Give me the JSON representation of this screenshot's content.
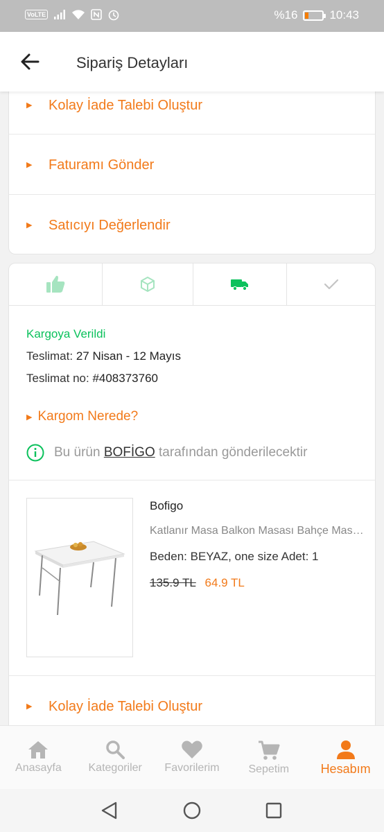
{
  "status_bar": {
    "network": "VoLTE",
    "battery_text": "%16",
    "battery_level": 0.16,
    "time": "10:43"
  },
  "header": {
    "title": "Sipariş Detayları",
    "back_icon": "arrow-left-icon"
  },
  "top_actions": [
    {
      "label": "Kolay İade Talebi Oluştur"
    },
    {
      "label": "Faturamı Gönder"
    },
    {
      "label": "Satıcıyı Değerlendir"
    }
  ],
  "tracking_steps": [
    {
      "icon": "thumbs-up-icon",
      "state": "done"
    },
    {
      "icon": "box-icon",
      "state": "done"
    },
    {
      "icon": "truck-icon",
      "state": "active"
    },
    {
      "icon": "check-icon",
      "state": "pending"
    }
  ],
  "shipment": {
    "status": "Kargoya Verildi",
    "delivery_label": "Teslimat:",
    "delivery_value": "27 Nisan - 12 Mayıs",
    "tracking_label": "Teslimat no:",
    "tracking_value": "#408373760",
    "where_link": "Kargom Nerede?",
    "info_prefix": "Bu ürün",
    "seller": "BOFİGO",
    "info_suffix": "tarafından gönderilecektir"
  },
  "product": {
    "brand": "Bofigo",
    "name": "Katlanır Masa Balkon Masası Bahçe Masası",
    "variant": "Beden: BEYAZ, one size Adet: 1",
    "old_price": "135.9 TL",
    "new_price": "64.9 TL"
  },
  "bottom_action": {
    "label": "Kolay İade Talebi Oluştur"
  },
  "bottom_nav": [
    {
      "label": "Anasayfa",
      "icon": "home-icon"
    },
    {
      "label": "Kategoriler",
      "icon": "search-icon"
    },
    {
      "label": "Favorilerim",
      "icon": "heart-icon"
    },
    {
      "label": "Sepetim",
      "icon": "cart-icon"
    },
    {
      "label": "Hesabım",
      "icon": "user-icon",
      "active": true
    }
  ],
  "colors": {
    "accent": "#f27a1a",
    "success": "#0bc15c",
    "muted": "#b5b5b5"
  }
}
